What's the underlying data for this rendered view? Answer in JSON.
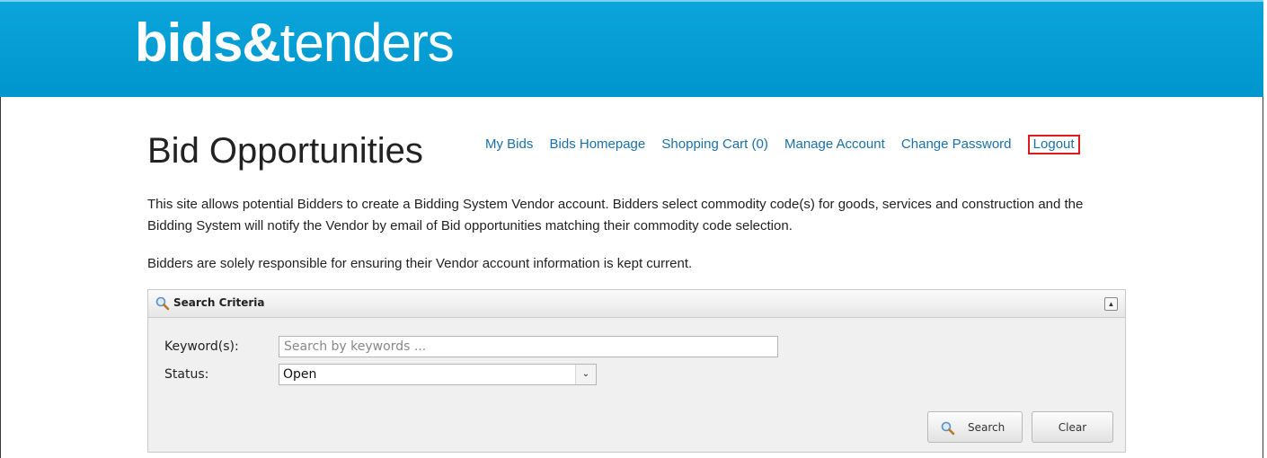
{
  "header": {
    "logo_bold": "bids&",
    "logo_light": "tenders"
  },
  "page": {
    "title": "Bid Opportunities"
  },
  "nav": {
    "my_bids": "My Bids",
    "bids_homepage": "Bids Homepage",
    "shopping_cart": "Shopping Cart (0)",
    "manage_account": "Manage Account",
    "change_password": "Change Password",
    "logout": "Logout"
  },
  "intro": {
    "paragraph": "This site allows potential Bidders to create a Bidding System Vendor account. Bidders select commodity code(s) for goods, services and construction and the Bidding System will notify the Vendor by email of Bid opportunities matching their commodity code selection.",
    "note": "Bidders are solely responsible for ensuring their Vendor account information is kept current."
  },
  "search": {
    "panel_title": "Search Criteria",
    "keyword_label": "Keyword(s):",
    "keyword_placeholder": "Search by keywords ...",
    "keyword_value": "",
    "status_label": "Status:",
    "status_value": "Open",
    "search_button": "Search",
    "clear_button": "Clear"
  },
  "colors": {
    "header": "#0aa5db",
    "link": "#1b6fa8",
    "highlight": "#e01820"
  },
  "icons": {
    "search": "magnifier-icon",
    "collapse": "collapse-up-icon",
    "dropdown": "chevron-down-icon"
  }
}
